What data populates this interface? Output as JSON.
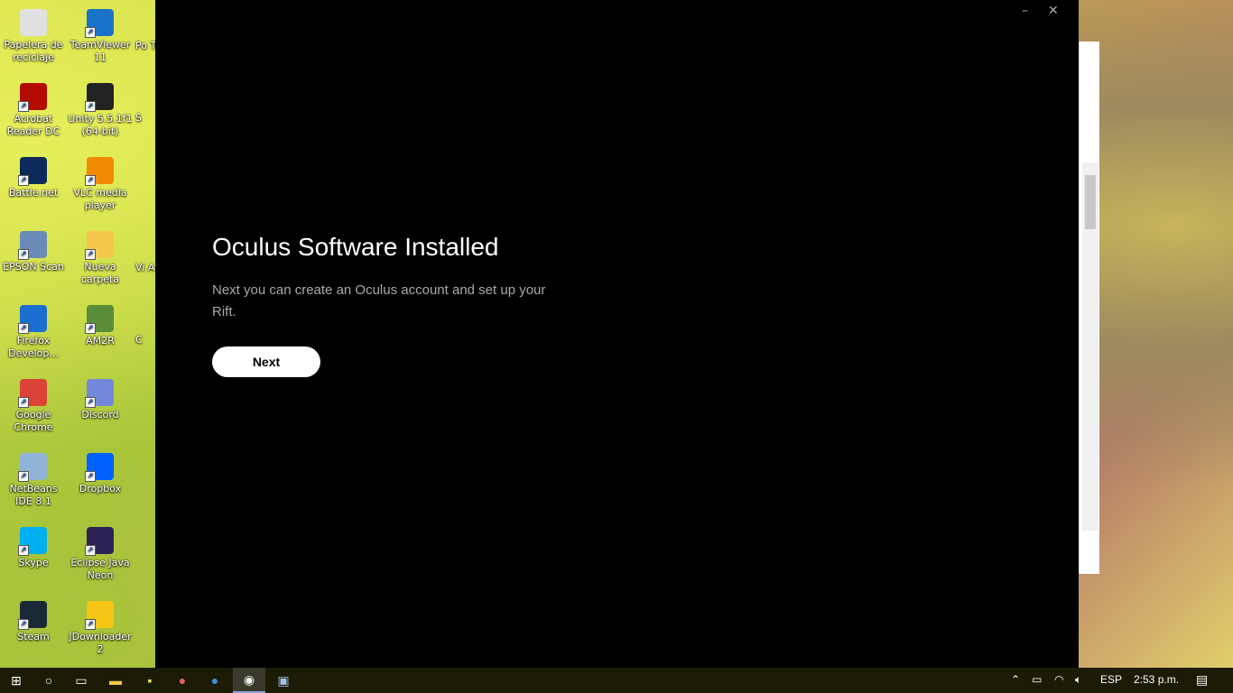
{
  "desktop_icons": [
    {
      "label": "Papelera de reciclaje",
      "icon": "recycle-bin-icon",
      "color": "#e0e0e0"
    },
    {
      "label": "TeamViewer 11",
      "icon": "teamviewer-icon",
      "color": "#1a73c9"
    },
    {
      "label": "Acrobat Reader DC",
      "icon": "acrobat-icon",
      "color": "#b30b00"
    },
    {
      "label": "Unity 5.5.1f1 (64-bit)",
      "icon": "unity-icon",
      "color": "#222222"
    },
    {
      "label": "Battle.net",
      "icon": "battlenet-icon",
      "color": "#0e2a5a"
    },
    {
      "label": "VLC media player",
      "icon": "vlc-icon",
      "color": "#f08a00"
    },
    {
      "label": "EPSON Scan",
      "icon": "epson-icon",
      "color": "#6a8bb8"
    },
    {
      "label": "Nueva carpeta",
      "icon": "folder-icon",
      "color": "#f2c94c"
    },
    {
      "label": "Firefox Develop...",
      "icon": "firefox-icon",
      "color": "#1a6fd1"
    },
    {
      "label": "AM2R",
      "icon": "am2r-icon",
      "color": "#5a8c3a"
    },
    {
      "label": "Google Chrome",
      "icon": "chrome-icon",
      "color": "#db4437"
    },
    {
      "label": "Discord",
      "icon": "discord-icon",
      "color": "#7289da"
    },
    {
      "label": "NetBeans IDE 8.1",
      "icon": "netbeans-icon",
      "color": "#8fb4d8"
    },
    {
      "label": "Dropbox",
      "icon": "dropbox-icon",
      "color": "#0061fe"
    },
    {
      "label": "Skype",
      "icon": "skype-icon",
      "color": "#00aff0"
    },
    {
      "label": "Eclipse Java Neon",
      "icon": "eclipse-icon",
      "color": "#2c2255"
    },
    {
      "label": "Steam",
      "icon": "steam-icon",
      "color": "#1b2838"
    },
    {
      "label": "JDownloader 2",
      "icon": "jdownloader-icon",
      "color": "#f5c518"
    }
  ],
  "partial_icons": [
    "Po Trav",
    "S",
    "Vi A",
    "C"
  ],
  "oculus": {
    "title": "Oculus Software Installed",
    "subtitle": "Next you can create an Oculus account and set up your Rift.",
    "next_label": "Next",
    "minimize": "–",
    "close": "✕"
  },
  "taskbar": {
    "language": "ESP",
    "time": "2:53 p.m."
  }
}
